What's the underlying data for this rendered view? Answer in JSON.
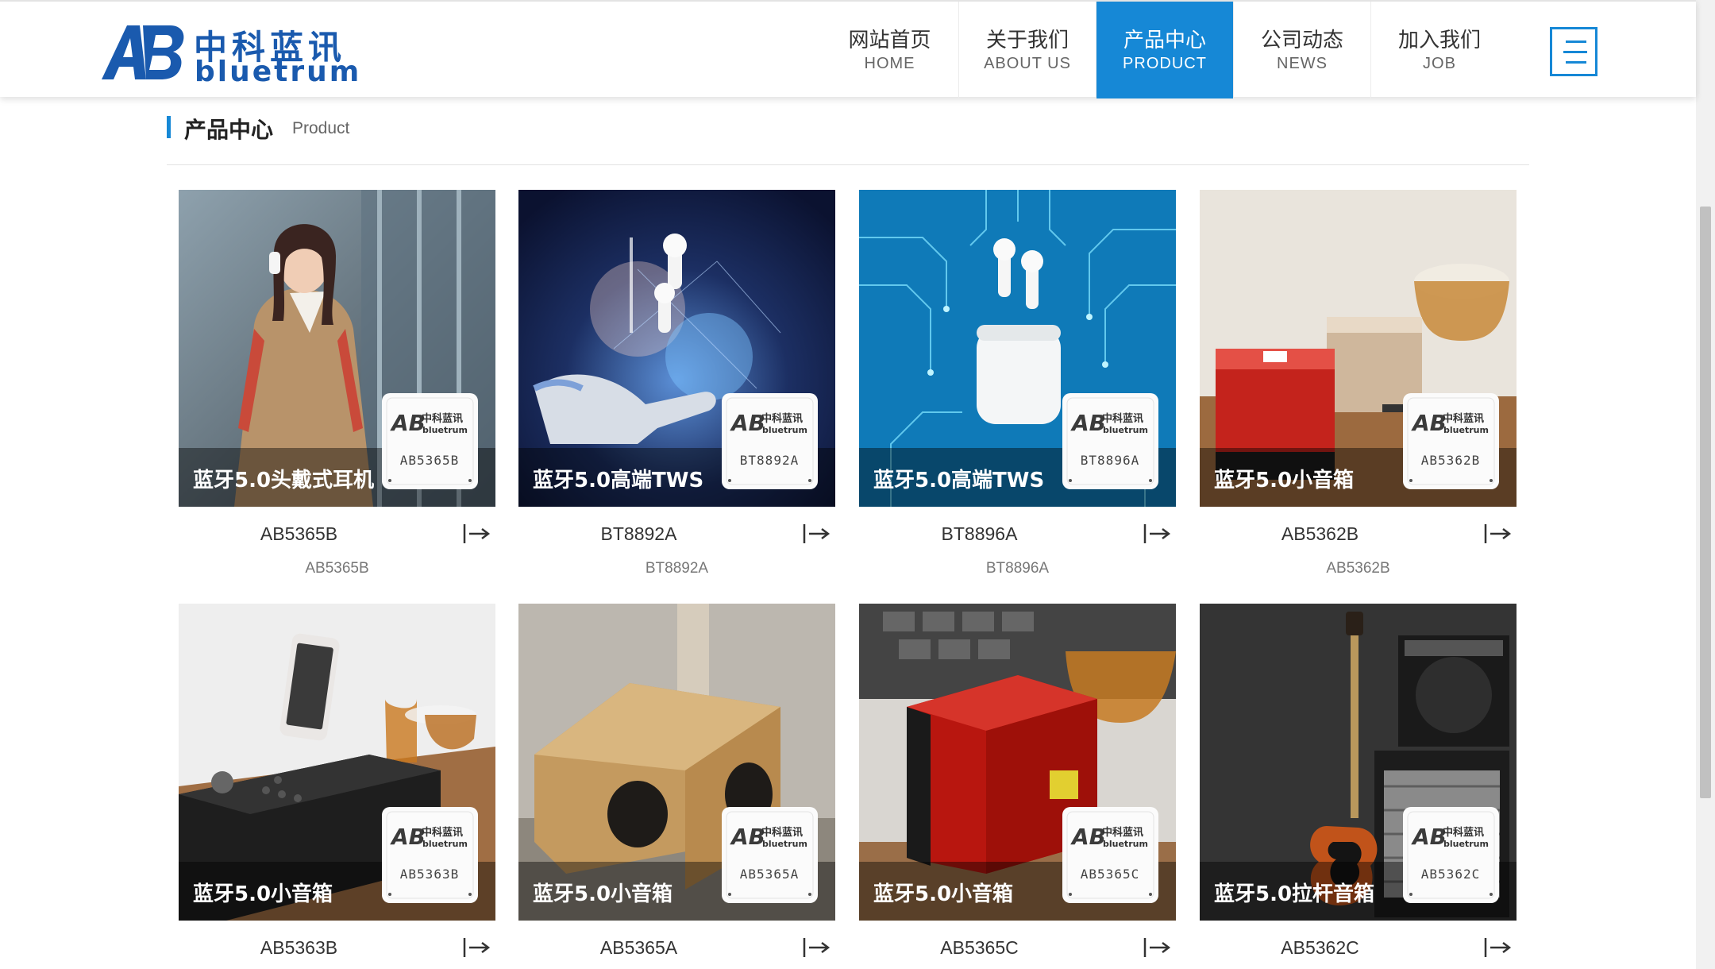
{
  "header": {
    "logo": {
      "cn": "中科蓝讯",
      "en": "bluetrum",
      "mark": "AB"
    },
    "nav": [
      {
        "cn": "网站首页",
        "en": "HOME",
        "active": false
      },
      {
        "cn": "关于我们",
        "en": "ABOUT US",
        "active": false
      },
      {
        "cn": "产品中心",
        "en": "PRODUCT",
        "active": true
      },
      {
        "cn": "公司动态",
        "en": "NEWS",
        "active": false
      },
      {
        "cn": "加入我们",
        "en": "JOB",
        "active": false
      }
    ],
    "menu_icon": "hamburger-menu-icon"
  },
  "section": {
    "title_cn": "产品中心",
    "title_en": "Product"
  },
  "products": [
    {
      "name": "AB5365B",
      "subtitle": "AB5365B",
      "banner": "蓝牙5.0头戴式耳机",
      "chip": "AB5365B"
    },
    {
      "name": "BT8892A",
      "subtitle": "BT8892A",
      "banner": "蓝牙5.0高端TWS",
      "chip": "BT8892A"
    },
    {
      "name": "BT8896A",
      "subtitle": "BT8896A",
      "banner": "蓝牙5.0高端TWS",
      "chip": "BT8896A"
    },
    {
      "name": "AB5362B",
      "subtitle": "AB5362B",
      "banner": "蓝牙5.0小音箱",
      "chip": "AB5362B"
    },
    {
      "name": "AB5363B",
      "subtitle": "",
      "banner": "蓝牙5.0小音箱",
      "chip": "AB5363B"
    },
    {
      "name": "AB5365A",
      "subtitle": "",
      "banner": "蓝牙5.0小音箱",
      "chip": "AB5365A"
    },
    {
      "name": "AB5365C",
      "subtitle": "",
      "banner": "蓝牙5.0小音箱",
      "chip": "AB5365C"
    },
    {
      "name": "AB5362C",
      "subtitle": "",
      "banner": "蓝牙5.0拉杆音箱",
      "chip": "AB5362C"
    }
  ],
  "chip_brand": {
    "cn": "中科蓝讯",
    "en": "bluetrum"
  },
  "colors": {
    "accent": "#1688d6",
    "logo": "#1a5aae"
  }
}
